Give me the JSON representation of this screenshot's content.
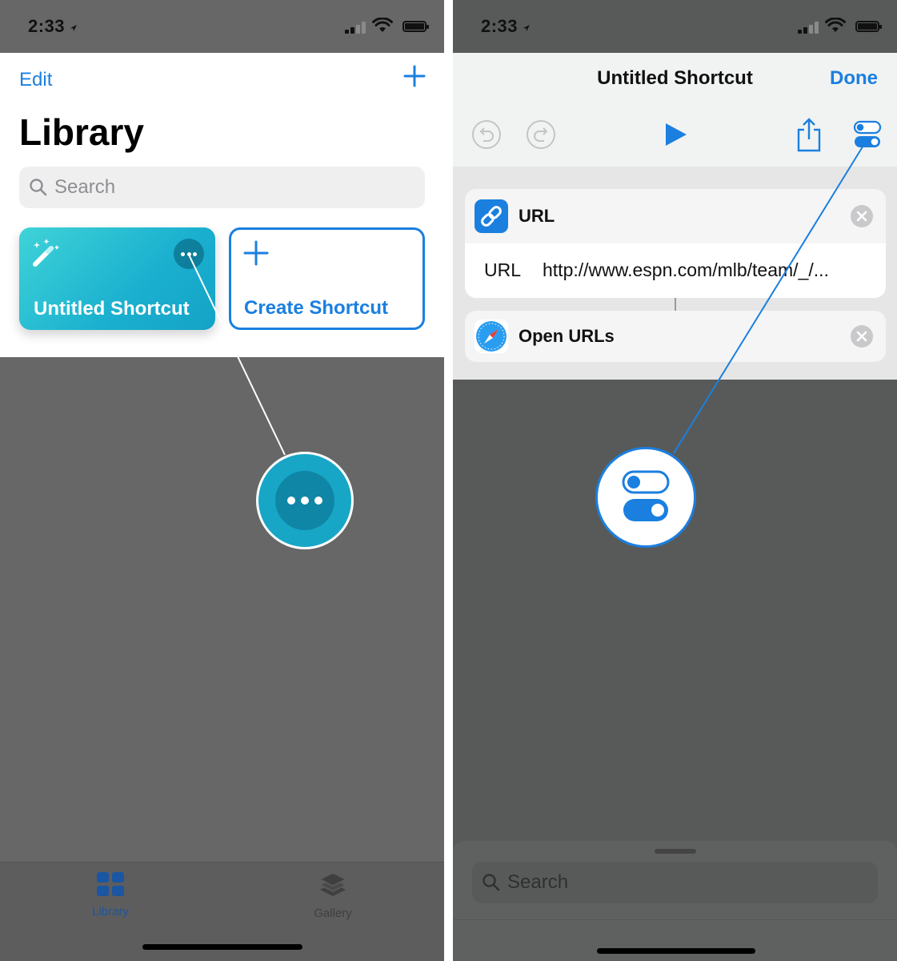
{
  "left": {
    "status": {
      "time": "2:33"
    },
    "header": {
      "edit_label": "Edit",
      "title": "Library",
      "search_placeholder": "Search"
    },
    "cards": {
      "shortcut_name": "Untitled Shortcut",
      "create_label": "Create Shortcut"
    },
    "tabs": [
      {
        "label": "Library"
      },
      {
        "label": "Gallery"
      }
    ]
  },
  "right": {
    "status": {
      "time": "2:33"
    },
    "header": {
      "title": "Untitled Shortcut",
      "done_label": "Done"
    },
    "actions": {
      "url_title": "URL",
      "url_key": "URL",
      "url_value": "http://www.espn.com/mlb/team/_/...",
      "open_title": "Open URLs"
    },
    "sheet": {
      "search_placeholder": "Search"
    }
  },
  "colors": {
    "accent": "#1b7fe0",
    "teal_card": "#1bb0cf",
    "callout_line_left": "#ffffff",
    "callout_line_right": "#1b7fe0"
  }
}
